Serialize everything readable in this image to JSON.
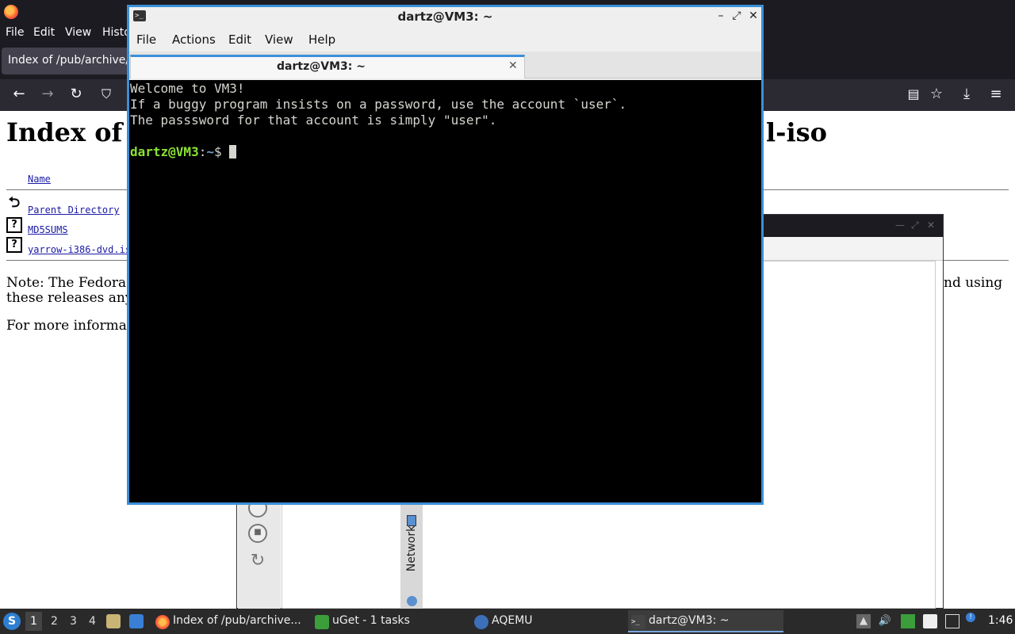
{
  "firefox": {
    "menu": {
      "file": "File",
      "edit": "Edit",
      "view": "View",
      "history": "Histo"
    },
    "tab_title": "Index of /pub/archive/f",
    "heading_left": "Index of",
    "heading_right": "l-iso",
    "column_name": "Name",
    "files": [
      {
        "name": "Parent Directory"
      },
      {
        "name": "MD5SUMS"
      },
      {
        "name": "yarrow-i386-dvd.is"
      }
    ],
    "note_line1": "Note: The Fedora r",
    "note_line1_tail": "nd using",
    "note_line2": "these releases any",
    "more_info": "For more informati"
  },
  "uget": {
    "vertical_tab": "Network"
  },
  "terminal": {
    "window_title": "dartz@VM3: ~",
    "menu": {
      "file": "File",
      "actions": "Actions",
      "edit": "Edit",
      "view": "View",
      "help": "Help"
    },
    "tab_title": "dartz@VM3: ~",
    "output": [
      "Welcome to VM3!",
      "If a buggy program insists on a password, use the account `user`.",
      "The passsword for that account is simply \"user\".",
      ""
    ],
    "prompt": {
      "user_host": "dartz@VM3",
      "sep": ":",
      "path": "~",
      "symbol": "$ "
    }
  },
  "taskbar": {
    "workspaces": [
      "1",
      "2",
      "3",
      "4"
    ],
    "tasks": [
      {
        "label": "Index of /pub/archive...",
        "icon": "firefox-icon"
      },
      {
        "label": "uGet - 1 tasks",
        "icon": "uget-icon"
      },
      {
        "label": "AQEMU",
        "icon": "aqemu-icon"
      },
      {
        "label": "dartz@VM3: ~",
        "icon": "terminal-icon"
      }
    ],
    "clock": "1:46"
  },
  "colors": {
    "terminal_accent": "#3a8fd8",
    "prompt_user": "#8ae234",
    "prompt_path": "#729fcf"
  }
}
